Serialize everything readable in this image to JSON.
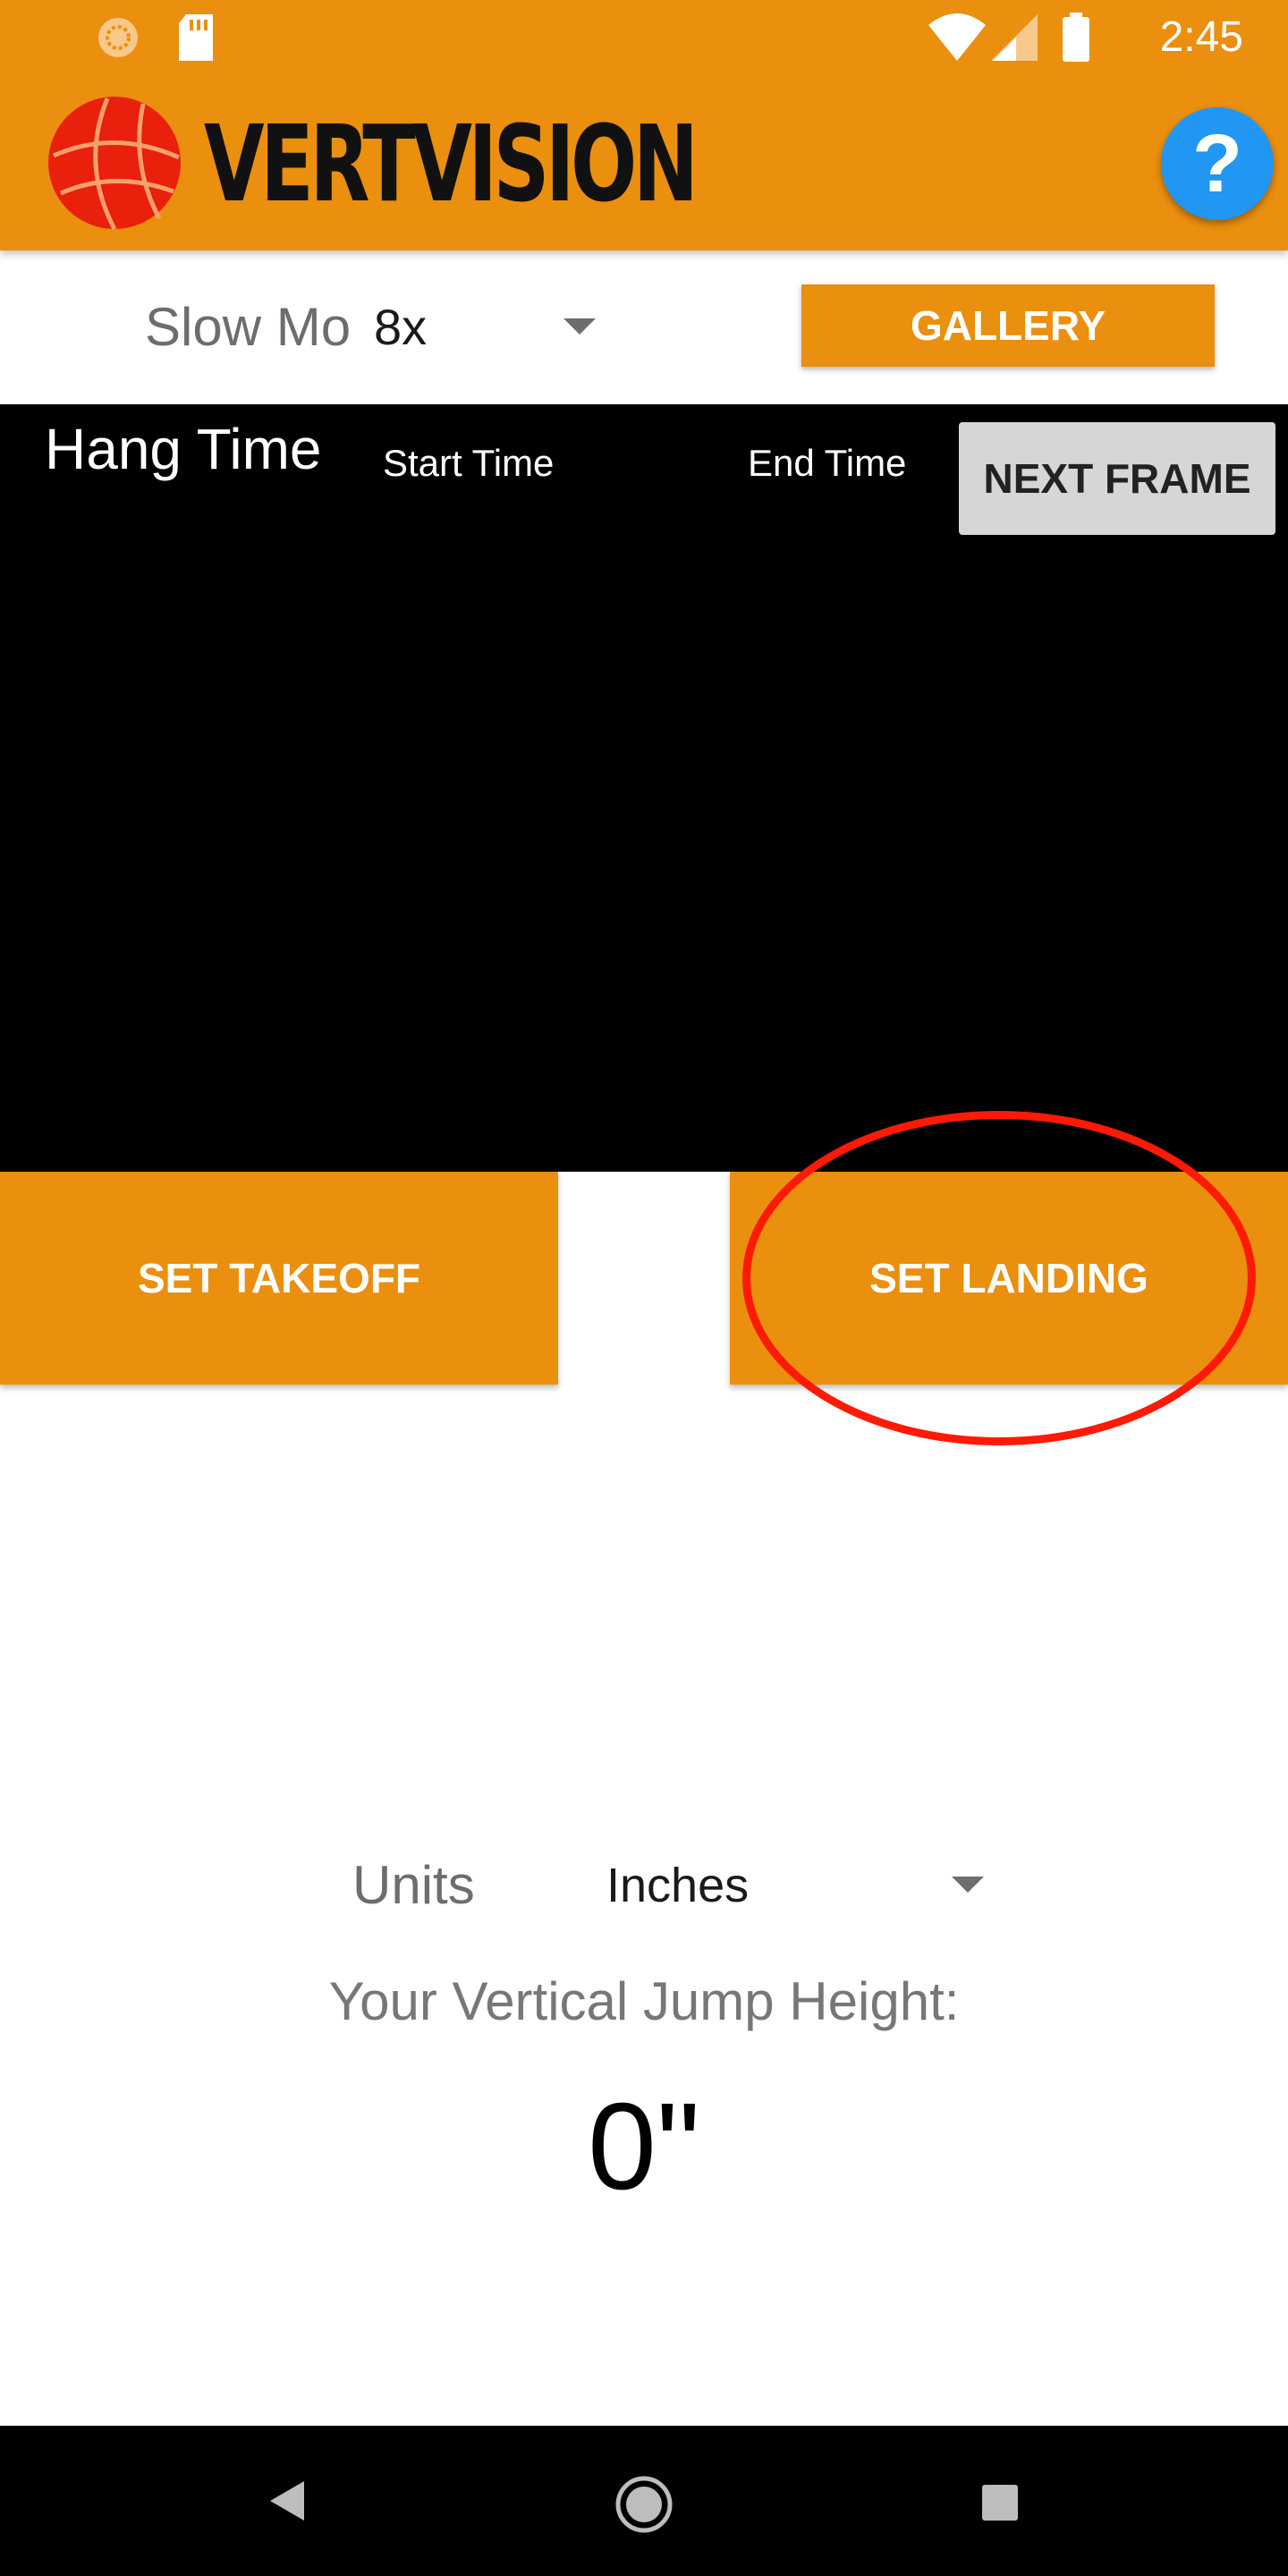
{
  "status_bar": {
    "time": "2:45",
    "icons": [
      "sync-icon",
      "sd-card-icon",
      "wifi-icon",
      "signal-icon",
      "battery-icon"
    ]
  },
  "app_bar": {
    "logo_text": "VERTVISION",
    "help_label": "?"
  },
  "controls": {
    "slowmo_label": "Slow Mo",
    "slowmo_value": "8x",
    "gallery_label": "GALLERY"
  },
  "video": {
    "hang_time_label": "Hang Time",
    "start_time_label": "Start Time",
    "end_time_label": "End Time",
    "next_frame_label": "NEXT FRAME"
  },
  "actions": {
    "set_takeoff_label": "SET TAKEOFF",
    "set_landing_label": "SET LANDING"
  },
  "results": {
    "units_label": "Units",
    "units_value": "Inches",
    "jump_height_label": "Your Vertical Jump Height:",
    "jump_height_value": "0\""
  },
  "colors": {
    "brand_orange": "#EA8F0E",
    "help_blue": "#2196F3",
    "annotation_red": "#FF1A05"
  }
}
